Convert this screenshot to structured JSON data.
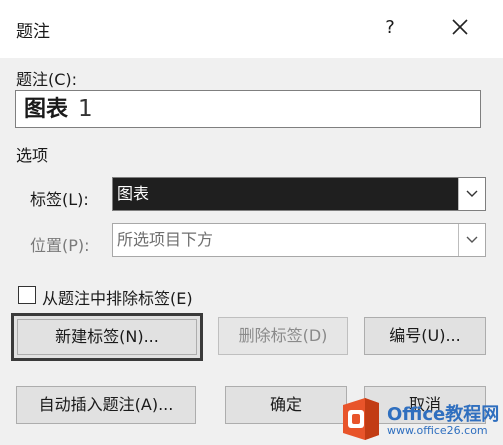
{
  "dialog": {
    "title": "题注",
    "help_label": "?",
    "close_icon": "close-icon"
  },
  "caption": {
    "label": "题注(C):",
    "value_bold": "图表",
    "value_number": "1"
  },
  "options": {
    "section_label": "选项",
    "label_field_label": "标签(L):",
    "label_field_value": "图表",
    "position_label": "位置(P):",
    "position_value": "所选项目下方"
  },
  "exclude_label": {
    "label": "从题注中排除标签(E)",
    "checked": false
  },
  "buttons": {
    "new_label": "新建标签(N)...",
    "delete_label": "删除标签(D)",
    "numbering": "编号(U)...",
    "autocaption": "自动插入题注(A)...",
    "ok": "确定",
    "cancel": "取消"
  },
  "watermark": {
    "brand": "Office教程网",
    "url": "www.office26.com",
    "icon": "office-logo-icon"
  }
}
